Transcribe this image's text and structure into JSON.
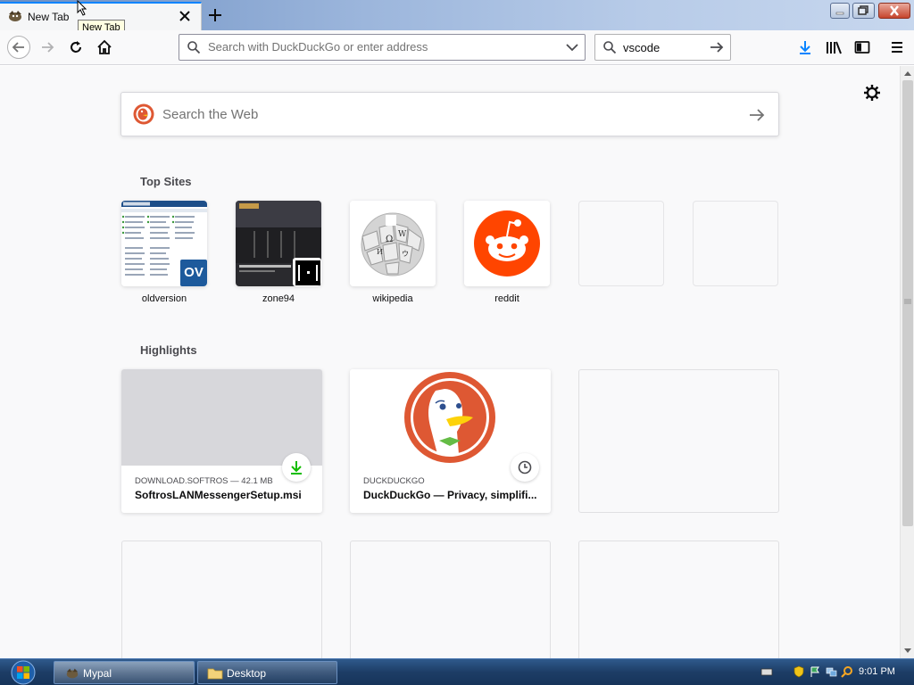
{
  "tab": {
    "title": "New Tab",
    "tooltip": "New Tab"
  },
  "navbar": {
    "url_placeholder": "Search with DuckDuckGo or enter address",
    "search_value": "vscode"
  },
  "newtab": {
    "search_placeholder": "Search the Web",
    "topsites_title": "Top Sites",
    "highlights_title": "Highlights",
    "top_sites": [
      {
        "label": "oldversion",
        "badge": "OV"
      },
      {
        "label": "zone94"
      },
      {
        "label": "wikipedia"
      },
      {
        "label": "reddit"
      }
    ],
    "highlights": [
      {
        "context": "DOWNLOAD.SOFTROS — 42.1 MB",
        "title": "SoftrosLANMessengerSetup.msi",
        "badge_icon": "download-icon"
      },
      {
        "context": "DUCKDUCKGO",
        "title": "DuckDuckGo — Privacy, simplifi...",
        "badge_icon": "clock-icon"
      }
    ]
  },
  "taskbar": {
    "items": [
      {
        "label": "Mypal"
      },
      {
        "label": "Desktop"
      }
    ],
    "clock": "9:01 PM"
  },
  "colors": {
    "accent": "#0a84ff",
    "reddit": "#ff4500",
    "duckduckgo": "#de5833"
  }
}
